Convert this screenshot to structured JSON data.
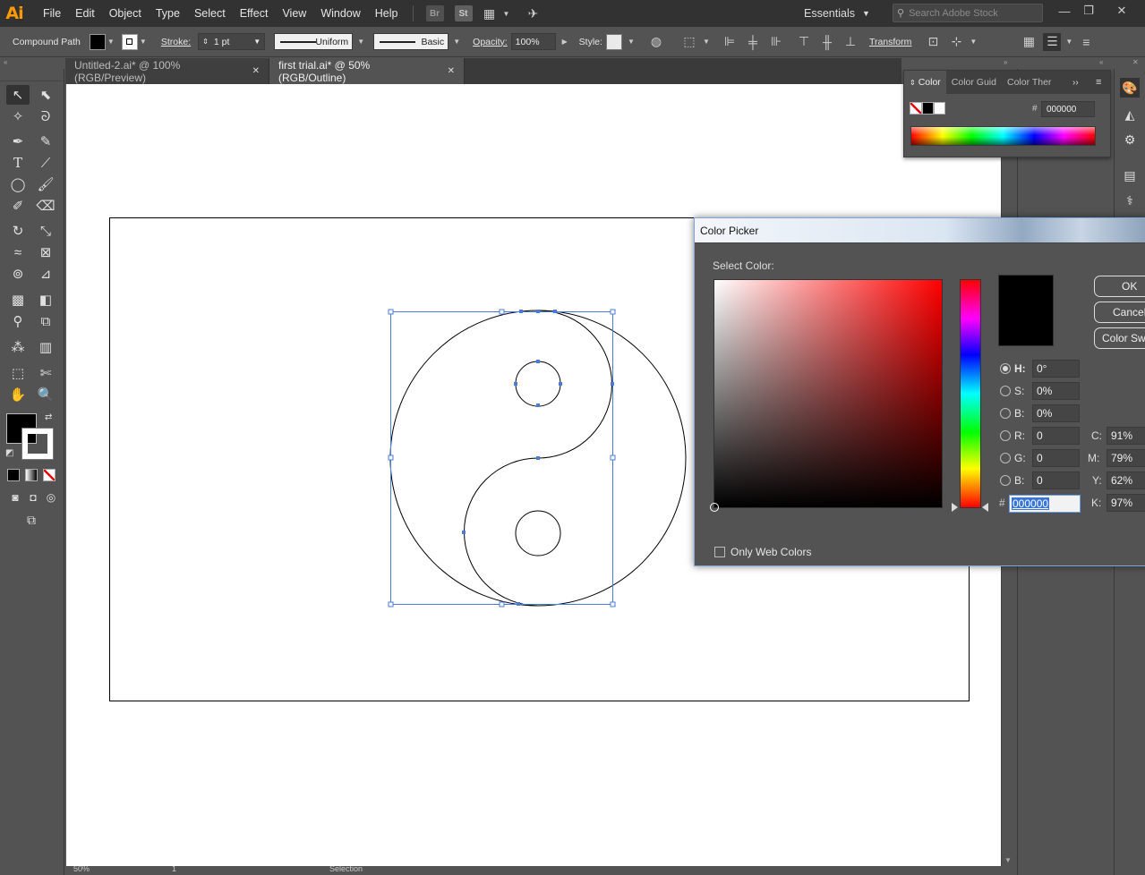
{
  "app": {
    "logo": "Ai",
    "menu": [
      "File",
      "Edit",
      "Object",
      "Type",
      "Select",
      "Effect",
      "View",
      "Window",
      "Help"
    ],
    "bridge_label": "Br",
    "stock_label": "St",
    "workspace": "Essentials",
    "search_placeholder": "Search Adobe Stock"
  },
  "control_bar": {
    "selection_type": "Compound Path",
    "stroke_label": "Stroke:",
    "stroke_weight": "1 pt",
    "variable_width": "Uniform",
    "brush": "Basic",
    "opacity_label": "Opacity:",
    "opacity": "100%",
    "style_label": "Style:",
    "transform_label": "Transform"
  },
  "tabs": [
    {
      "label": "Untitled-2.ai* @ 100% (RGB/Preview)",
      "close": "✕"
    },
    {
      "label": "first trial.ai* @ 50% (RGB/Outline)",
      "close": "✕"
    }
  ],
  "color_panel": {
    "tabs": [
      "Color",
      "Color Guid",
      "Color Ther"
    ],
    "hex_label": "#",
    "hex": "000000"
  },
  "color_picker": {
    "title": "Color Picker",
    "select_label": "Select Color:",
    "fields": [
      {
        "label": "H:",
        "value": "0°"
      },
      {
        "label": "S:",
        "value": "0%"
      },
      {
        "label": "B:",
        "value": "0%"
      },
      {
        "label": "R:",
        "value": "0"
      },
      {
        "label": "G:",
        "value": "0"
      },
      {
        "label": "B:",
        "value": "0"
      }
    ],
    "cmyk": [
      {
        "label": "C:",
        "value": "91%"
      },
      {
        "label": "M:",
        "value": "79%"
      },
      {
        "label": "Y:",
        "value": "62%"
      },
      {
        "label": "K:",
        "value": "97%"
      }
    ],
    "hex_label": "#",
    "hex": "000000",
    "buttons": [
      "OK",
      "Cancel",
      "Color Swatches"
    ],
    "only_web_colors": "Only Web Colors",
    "current_color": "#000000"
  },
  "status_bar": {
    "zoom": "50%",
    "artboard": "1",
    "tool": "Selection"
  }
}
